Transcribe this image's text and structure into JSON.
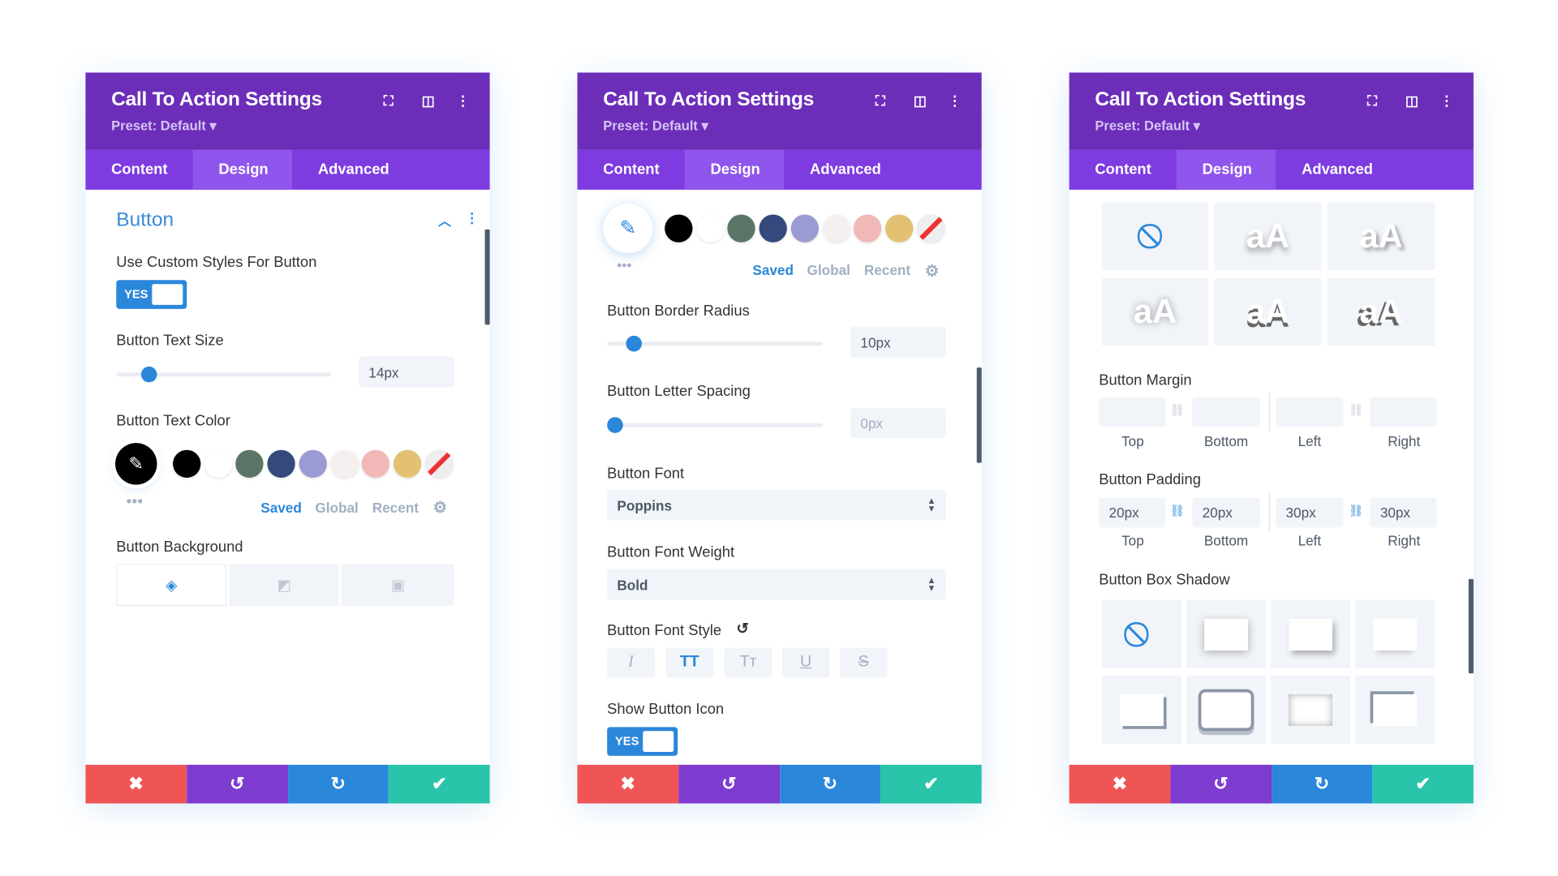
{
  "colors": {
    "header": "#6c2eb9",
    "tabs": "#7d3be0",
    "tab_active": "#8f55ec",
    "accent": "#2b87da",
    "cancel": "#ef5555",
    "undo": "#7e3bd0",
    "redo": "#2b87da",
    "save": "#29c4a9"
  },
  "panel": {
    "title": "Call To Action Settings",
    "preset": "Preset: Default ▾",
    "tabs": [
      "Content",
      "Design",
      "Advanced"
    ],
    "active_tab": "Design",
    "icons": [
      "expand-icon",
      "split-view-icon",
      "more-icon"
    ],
    "footer": [
      "cancel-icon",
      "undo-icon",
      "redo-icon",
      "save-icon"
    ]
  },
  "palette": {
    "swatches": [
      "#000000",
      "#ffffff",
      "#5a7566",
      "#344a7d",
      "#9b9bd3",
      "#f5f0ef",
      "#f0b9b8",
      "#e2c272",
      "transparent"
    ],
    "tabs": [
      "Saved",
      "Global",
      "Recent"
    ],
    "active": "Saved"
  },
  "p1": {
    "section": "Button",
    "custom_label": "Use Custom Styles For Button",
    "toggle": "YES",
    "text_size_label": "Button Text Size",
    "text_size": "14px",
    "text_size_fraction": 0.15,
    "text_color_label": "Button Text Color",
    "text_color": "#000000",
    "background_label": "Button Background",
    "background_tabs": [
      "color-icon",
      "gradient-icon",
      "image-icon"
    ]
  },
  "p2": {
    "border_radius_label": "Button Border Radius",
    "border_radius": "10px",
    "border_radius_fraction": 0.12,
    "letter_spacing_label": "Button Letter Spacing",
    "letter_spacing": "0px",
    "letter_spacing_fraction": 0.03,
    "font_label": "Button Font",
    "font": "Poppins",
    "weight_label": "Button Font Weight",
    "weight": "Bold",
    "style_label": "Button Font Style",
    "styles": [
      "I",
      "TT",
      "Tт",
      "U",
      "S"
    ],
    "active_style": "TT",
    "icon_label": "Show Button Icon",
    "icon_toggle": "YES"
  },
  "p3": {
    "text_shadow_sample": "aA",
    "margin_label": "Button Margin",
    "margin": [
      "",
      "",
      "",
      ""
    ],
    "padding_label": "Button Padding",
    "padding": [
      "20px",
      "20px",
      "30px",
      "30px"
    ],
    "sides": [
      "Top",
      "Bottom",
      "Left",
      "Right"
    ],
    "box_shadow_label": "Button Box Shadow"
  }
}
